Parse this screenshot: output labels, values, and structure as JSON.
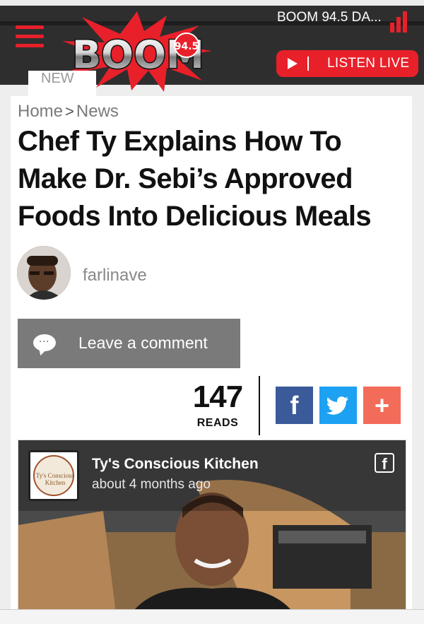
{
  "header": {
    "station_name": "BOOM 94.5 DA...",
    "listen_label": "LISTEN LIVE",
    "logo_text": "BOOM",
    "logo_freq": "94.5",
    "colors": {
      "accent": "#e8202a",
      "header_bg": "#2e2e2e"
    }
  },
  "nav": {
    "tab_label": "NEW"
  },
  "breadcrumb": {
    "home": "Home",
    "separator": ">",
    "section": "News"
  },
  "article": {
    "title": "Chef Ty Explains How To Make Dr. Sebi’s Approved Foods Into Delicious Meals",
    "author": "farlinave"
  },
  "comment": {
    "label": "Leave a comment"
  },
  "stats": {
    "reads_count": "147",
    "reads_label": "READS"
  },
  "share": {
    "facebook_glyph": "f",
    "more_glyph": "+"
  },
  "video": {
    "channel_name": "Ty's Conscious Kitchen",
    "posted": "about 4 months ago",
    "channel_logo_text": "Ty's Conscious Kitchen",
    "fb_glyph": "f"
  }
}
